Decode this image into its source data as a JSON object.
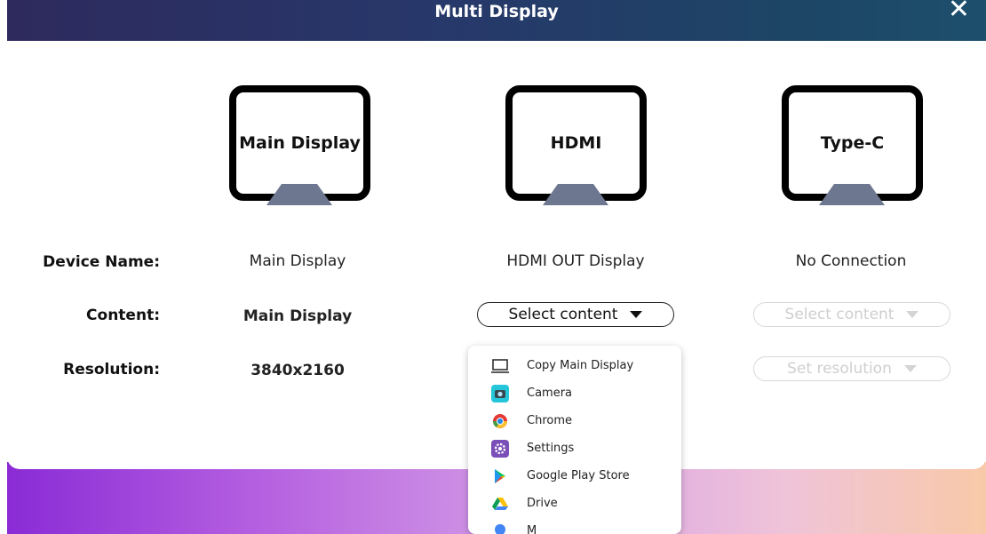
{
  "window": {
    "title": "Multi Display",
    "close_glyph": "✕"
  },
  "displays": [
    {
      "screen_label": "Main Display",
      "device_name": "Main Display",
      "content": "Main Display",
      "resolution": "3840x2160"
    },
    {
      "screen_label": "HDMI",
      "device_name": "HDMI OUT Display",
      "content_select": "Select content"
    },
    {
      "screen_label": "Type-C",
      "device_name": "No Connection",
      "content_select": "Select content",
      "resolution_select": "Set resolution"
    }
  ],
  "labels": {
    "device_name": "Device Name:",
    "content": "Content:",
    "resolution": "Resolution:"
  },
  "dropdown": {
    "items": [
      {
        "label": "Copy Main Display",
        "icon": "monitor-icon"
      },
      {
        "label": "Camera",
        "icon": "camera-icon"
      },
      {
        "label": "Chrome",
        "icon": "chrome-icon"
      },
      {
        "label": "Settings",
        "icon": "settings-icon"
      },
      {
        "label": "Google Play Store",
        "icon": "play-store-icon"
      },
      {
        "label": "Drive",
        "icon": "drive-icon"
      },
      {
        "label": "M",
        "icon": "maps-icon"
      }
    ]
  },
  "colors": {
    "header_start": "#2e2a5e",
    "header_end": "#1d4f6c",
    "stand": "#6e7790",
    "disabled_text": "#cfcfcf"
  }
}
